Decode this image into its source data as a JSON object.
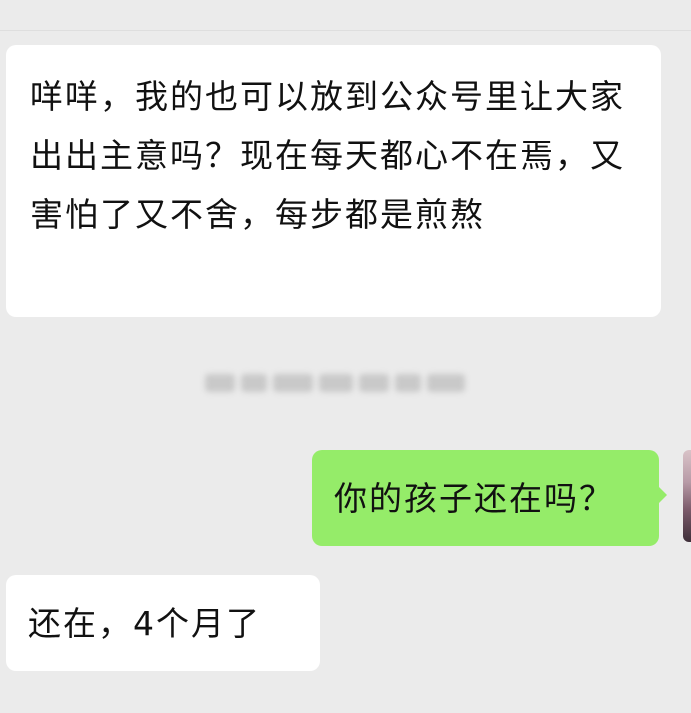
{
  "messages": [
    {
      "direction": "received",
      "text": "咩咩，我的也可以放到公众号里让大家出出主意吗？现在每天都心不在焉，又害怕了又不舍，每步都是煎熬"
    },
    {
      "direction": "sent",
      "text": "你的孩子还在吗？"
    },
    {
      "direction": "received",
      "text": "还在，4个月了"
    }
  ],
  "colors": {
    "background": "#ebebeb",
    "received_bubble": "#ffffff",
    "sent_bubble": "#95ec69",
    "text": "#111111"
  }
}
